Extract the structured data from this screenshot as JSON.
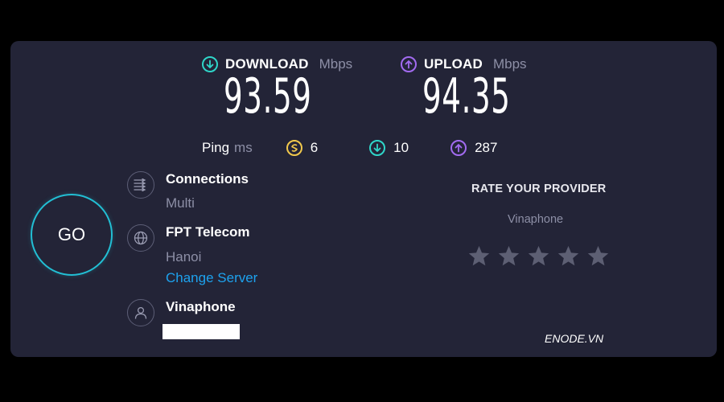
{
  "download": {
    "label": "DOWNLOAD",
    "unit": "Mbps",
    "value": "93.59",
    "color": "#2fd6c9"
  },
  "upload": {
    "label": "UPLOAD",
    "unit": "Mbps",
    "value": "94.35",
    "color": "#a26bf0"
  },
  "ping": {
    "label": "Ping",
    "unit": "ms",
    "idle": "6",
    "download": "10",
    "upload": "287",
    "idle_color": "#f2c94c"
  },
  "go_label": "GO",
  "connections": {
    "title": "Connections",
    "value": "Multi"
  },
  "server": {
    "name": "FPT Telecom",
    "location": "Hanoi",
    "change_label": "Change Server"
  },
  "provider": {
    "name": "Vinaphone"
  },
  "rating": {
    "title": "RATE YOUR PROVIDER",
    "provider": "Vinaphone",
    "stars_total": 5,
    "stars_selected": 0
  },
  "watermark": "ENODE.VN"
}
